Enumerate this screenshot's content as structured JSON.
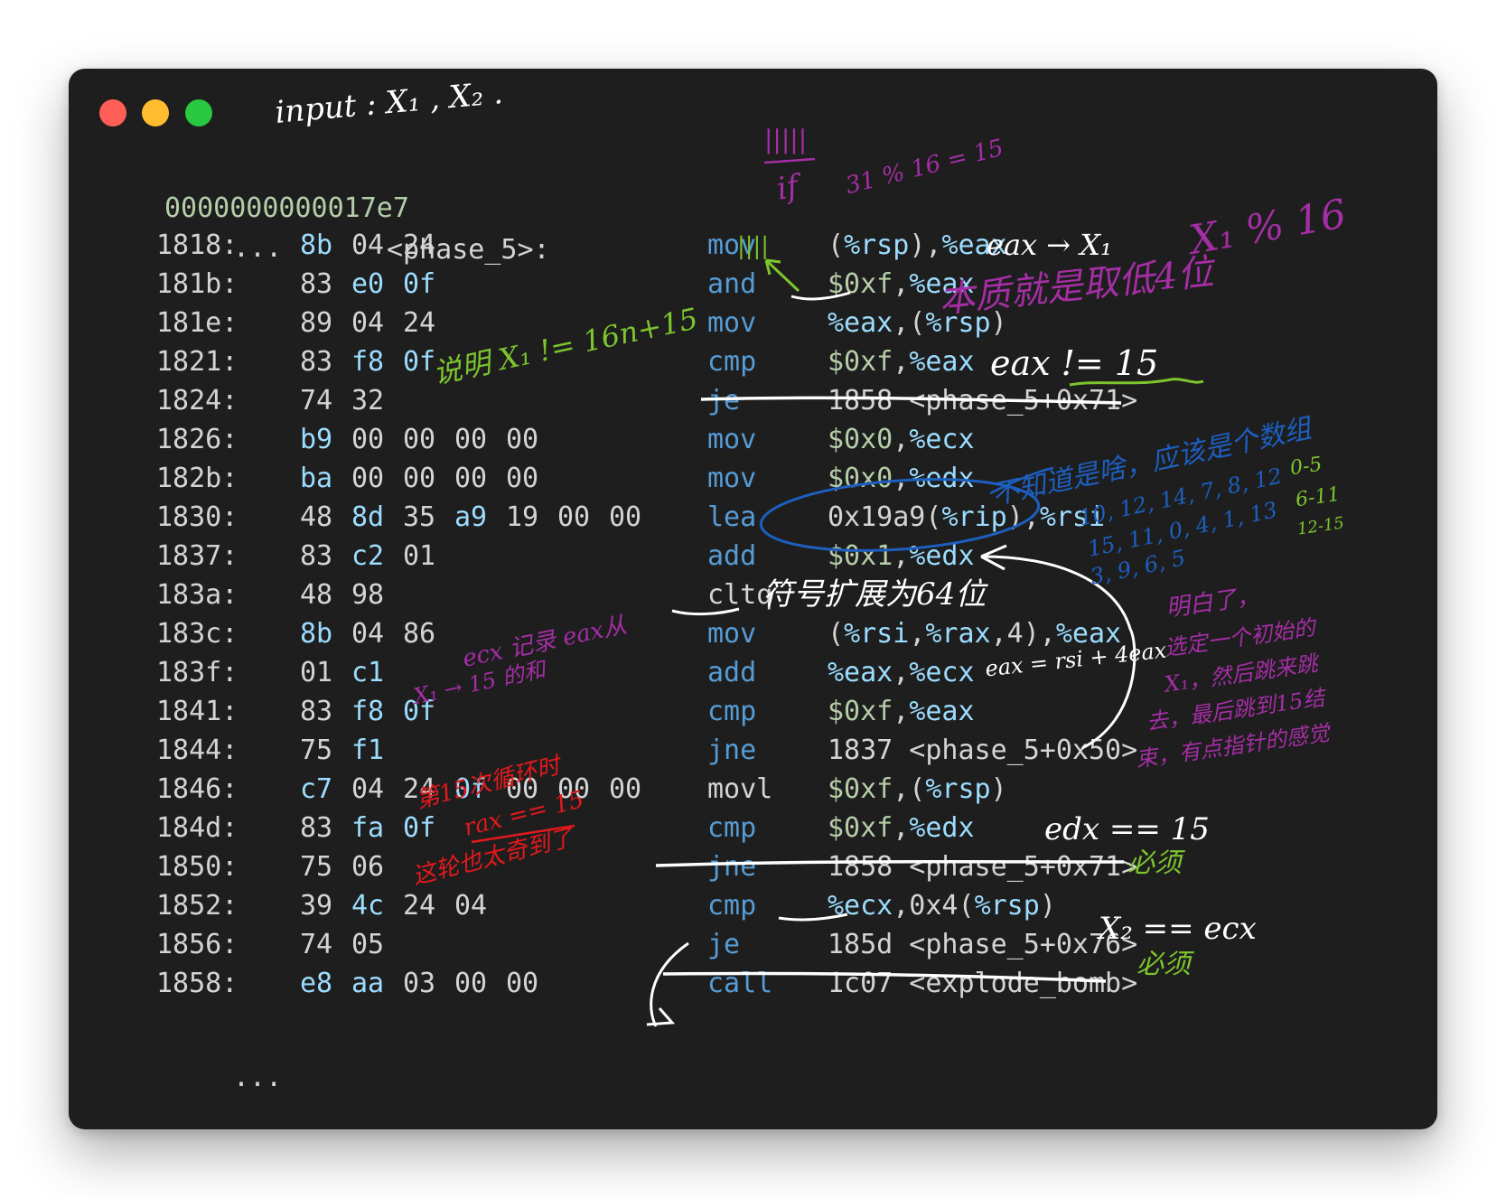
{
  "header": {
    "address": "0000000000017e7",
    "symbol": "<phase_5>:"
  },
  "ellipsis_top": "...",
  "ellipsis_bottom": "...",
  "instructions": [
    {
      "addr": "1818:",
      "bytes": [
        "8b",
        "04",
        "24"
      ],
      "mnemonic": "mov",
      "operands": "(%rsp),%eax"
    },
    {
      "addr": "181b:",
      "bytes": [
        "83",
        "e0",
        "0f"
      ],
      "mnemonic": "and",
      "operands": "$0xf,%eax"
    },
    {
      "addr": "181e:",
      "bytes": [
        "89",
        "04",
        "24"
      ],
      "mnemonic": "mov",
      "operands": "%eax,(%rsp)"
    },
    {
      "addr": "1821:",
      "bytes": [
        "83",
        "f8",
        "0f"
      ],
      "mnemonic": "cmp",
      "operands": "$0xf,%eax"
    },
    {
      "addr": "1824:",
      "bytes": [
        "74",
        "32"
      ],
      "mnemonic": "je",
      "operands": "1858 <phase_5+0x71>"
    },
    {
      "addr": "1826:",
      "bytes": [
        "b9",
        "00",
        "00",
        "00",
        "00"
      ],
      "mnemonic": "mov",
      "operands": "$0x0,%ecx"
    },
    {
      "addr": "182b:",
      "bytes": [
        "ba",
        "00",
        "00",
        "00",
        "00"
      ],
      "mnemonic": "mov",
      "operands": "$0x0,%edx"
    },
    {
      "addr": "1830:",
      "bytes": [
        "48",
        "8d",
        "35",
        "a9",
        "19",
        "00",
        "00"
      ],
      "mnemonic": "lea",
      "operands": "0x19a9(%rip),%rsi"
    },
    {
      "addr": "1837:",
      "bytes": [
        "83",
        "c2",
        "01"
      ],
      "mnemonic": "add",
      "operands": "$0x1,%edx"
    },
    {
      "addr": "183a:",
      "bytes": [
        "48",
        "98"
      ],
      "mnemonic": "cltq",
      "operands": ""
    },
    {
      "addr": "183c:",
      "bytes": [
        "8b",
        "04",
        "86"
      ],
      "mnemonic": "mov",
      "operands": "(%rsi,%rax,4),%eax"
    },
    {
      "addr": "183f:",
      "bytes": [
        "01",
        "c1"
      ],
      "mnemonic": "add",
      "operands": "%eax,%ecx"
    },
    {
      "addr": "1841:",
      "bytes": [
        "83",
        "f8",
        "0f"
      ],
      "mnemonic": "cmp",
      "operands": "$0xf,%eax"
    },
    {
      "addr": "1844:",
      "bytes": [
        "75",
        "f1"
      ],
      "mnemonic": "jne",
      "operands": "1837 <phase_5+0x50>"
    },
    {
      "addr": "1846:",
      "bytes": [
        "c7",
        "04",
        "24",
        "0f",
        "00",
        "00",
        "00"
      ],
      "mnemonic": "movl",
      "operands": "$0xf,(%rsp)"
    },
    {
      "addr": "184d:",
      "bytes": [
        "83",
        "fa",
        "0f"
      ],
      "mnemonic": "cmp",
      "operands": "$0xf,%edx"
    },
    {
      "addr": "1850:",
      "bytes": [
        "75",
        "06"
      ],
      "mnemonic": "jne",
      "operands": "1858 <phase_5+0x71>"
    },
    {
      "addr": "1852:",
      "bytes": [
        "39",
        "4c",
        "24",
        "04"
      ],
      "mnemonic": "cmp",
      "operands": "%ecx,0x4(%rsp)"
    },
    {
      "addr": "1856:",
      "bytes": [
        "74",
        "05"
      ],
      "mnemonic": "je",
      "operands": "185d <phase_5+0x76>"
    },
    {
      "addr": "1858:",
      "bytes": [
        "e8",
        "aa",
        "03",
        "00",
        "00"
      ],
      "mnemonic": "call",
      "operands": "1c07 <explode_bomb>"
    }
  ],
  "annotations": {
    "input": "input : X₁ , X₂ .",
    "tally_top": "|||||",
    "if_note": "if",
    "mod_note": "31 % 16 = 15",
    "tally_mov": "||||",
    "eax_x1": "eax → X₁",
    "x1_mod16": "X₁ % 16",
    "low4bits": "本质就是取低4位",
    "x1_ne": "说明 X₁ != 16n+15",
    "eax_ne15": "eax != 15",
    "unknown_array": "不知道是啥，应该是个数组",
    "array_row1": "10, 12, 14, 7, 8, 12",
    "array_row2": "15, 11, 0, 4, 1, 13",
    "array_row3": "3, 9, 6, 5",
    "range1": "0-5",
    "range2": "6-11",
    "range3": "12-15",
    "sign_extend": "符号扩展为64位",
    "eax_rsi": "eax = rsi + 4eax",
    "ecx_note1": "ecx 记录 eax从",
    "ecx_note2": "X₁ → 15 的和",
    "understood1": "明白了，",
    "understood2": "选定一个初始的",
    "understood3": "X₁，然后跳来跳",
    "understood4": "去，最后跳到15结",
    "understood5": "束，有点指针的感觉",
    "red1": "第15次循环时",
    "red2": "rax == 15",
    "red3": "这轮也太奇到了",
    "edx15": "edx == 15",
    "must1": "必须",
    "x2ecx": "X₂ == ecx",
    "must2": "必须"
  },
  "colors": {
    "window_bg": "#1e1e1e",
    "mnemonic": "#569cd6",
    "register": "#9cdcfe",
    "immediate": "#b5cea8",
    "text": "#d4d4d4",
    "ink_white": "#ffffff",
    "ink_purple": "#a52ea5",
    "ink_green": "#7cc52d",
    "ink_blue": "#1d5fbf",
    "ink_red": "#e3191c"
  }
}
